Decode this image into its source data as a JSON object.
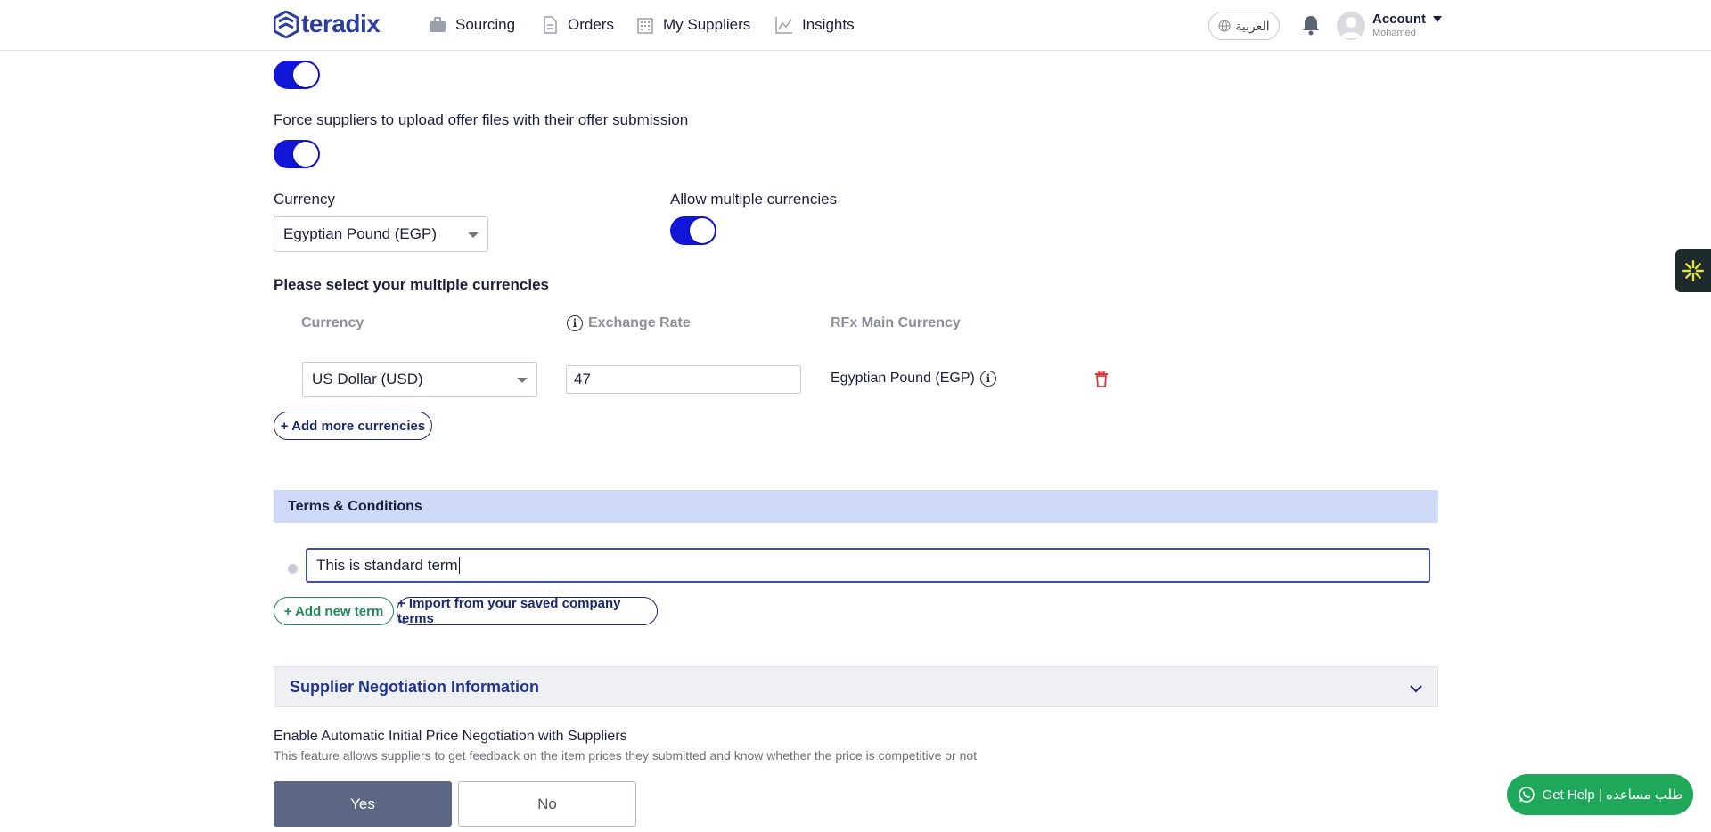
{
  "nav": {
    "brand": "teradix",
    "items": [
      {
        "label": "Sourcing",
        "icon": "briefcase-icon"
      },
      {
        "label": "Orders",
        "icon": "document-icon"
      },
      {
        "label": "My Suppliers",
        "icon": "building-icon"
      },
      {
        "label": "Insights",
        "icon": "chart-line-icon"
      }
    ],
    "language_label": "العربية",
    "account_label": "Account",
    "account_user": "Mohamed"
  },
  "settings": {
    "force_upload_label": "Force suppliers to upload offer files with their offer submission",
    "currency_label": "Currency",
    "currency_value": "Egyptian Pound (EGP)",
    "allow_multiple_label": "Allow multiple currencies",
    "toggles": {
      "top": true,
      "force_upload": true,
      "allow_multiple": true
    }
  },
  "currencies": {
    "section_label": "Please select your multiple currencies",
    "headers": {
      "currency": "Currency",
      "exchange_rate": "Exchange Rate",
      "main_currency": "RFx Main Currency"
    },
    "rows": [
      {
        "currency": "US Dollar (USD)",
        "exchange_rate": "47",
        "main_currency": "Egyptian Pound (EGP)"
      }
    ],
    "add_more_label": "+ Add more currencies"
  },
  "terms": {
    "title": "Terms & Conditions",
    "items": [
      "This is standard term"
    ],
    "add_new_label": "+ Add new term",
    "import_label": "+ Import from your saved company terms"
  },
  "negotiation": {
    "title": "Supplier Negotiation Information",
    "enable_label": "Enable Automatic Initial Price Negotiation with Suppliers",
    "description": "This feature allows suppliers to get feedback on the item prices they submitted and know whether the price is competitive or not",
    "yes_label": "Yes",
    "no_label": "No",
    "selected": "Yes"
  },
  "help": {
    "label": "Get Help | طلب مساعده"
  },
  "colors": {
    "brand": "#2c3f9e",
    "toggle": "#1116d9",
    "section": "#cdd9f6",
    "help": "#1fa85a",
    "selected": "#5c6883"
  }
}
